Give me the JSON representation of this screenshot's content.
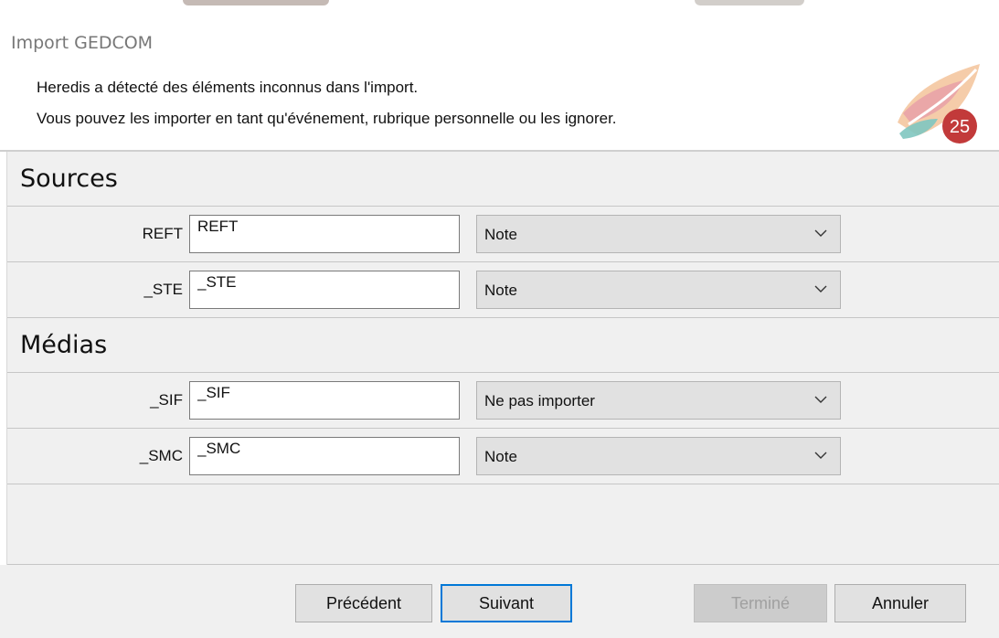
{
  "window": {
    "title": "Import GEDCOM"
  },
  "header": {
    "line1": "Heredis a détecté des éléments inconnus dans l'import.",
    "line2": "Vous pouvez les importer en tant qu'événement, rubrique personnelle ou les ignorer.",
    "logo": {
      "icon": "heredis-leaf-logo-icon",
      "badge_text": "25",
      "colors": [
        "#e8a0a8",
        "#f4c6a0",
        "#7fc6c0",
        "#c23a3a"
      ]
    }
  },
  "sections": [
    {
      "title": "Sources",
      "rows": [
        {
          "tag": "REFT",
          "input_value": "REFT",
          "select_value": "Note"
        },
        {
          "tag": "_STE",
          "input_value": "_STE",
          "select_value": "Note"
        }
      ]
    },
    {
      "title": "Médias",
      "rows": [
        {
          "tag": "_SIF",
          "input_value": "_SIF",
          "select_value": "Ne pas importer"
        },
        {
          "tag": "_SMC",
          "input_value": "_SMC",
          "select_value": "Note"
        }
      ]
    }
  ],
  "footer": {
    "previous_label": "Précédent",
    "next_label": "Suivant",
    "finish_label": "Terminé",
    "cancel_label": "Annuler"
  },
  "colors": {
    "content_bg": "#f0f0f0",
    "focus_border": "#0078d7",
    "disabled_text": "#a0a0a0"
  }
}
